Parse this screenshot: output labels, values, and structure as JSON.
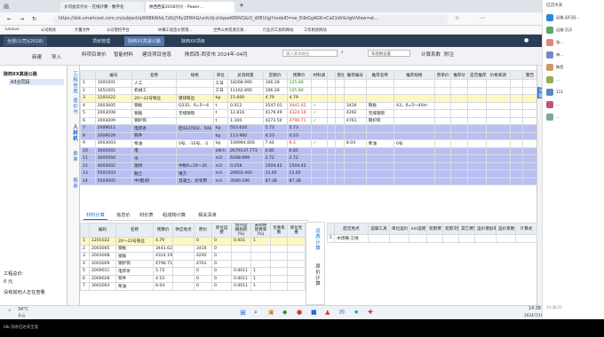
{
  "browser": {
    "tabs": [
      {
        "label": "大司会云计价 - 在线计算 - 数字化",
        "active": false
      },
      {
        "label": "陕西西安2018计价 - Power…",
        "active": true
      }
    ],
    "url": "https://dsk.smartcost.com.cn/subject/qW6BKAIfoL7d0/jY4y2EWhG/unit/dj-zUqewKRNVQ&i3_d0EU/gj?nodeID=oe_EdbGgAGK-nCa01dV&rightView=at...",
    "bookmarks": [
      "Lenovo",
      "公司相关",
      "计量文件",
      "公司管控平台",
      "纵横工程造价管理...",
      "世界公共资源交易...",
      "行业内工具和网站",
      "工作相关网站"
    ]
  },
  "app": {
    "tabs": [
      "全部(公司)(2018)",
      "项目管理",
      "陕西XX高速公路",
      "陕西XX项目"
    ],
    "toolbar": [
      "新建",
      "导入",
      "导出",
      "复制",
      "删除",
      "移动",
      "展开"
    ],
    "nav_labels": [
      "料项目单价",
      "智能材料",
      "建设项目信息",
      "陕西西-西安市 2024年-04月"
    ],
    "search_placeholder": "输入基本路径",
    "right_controls": [
      "车船税设置",
      "计算系数",
      "附注"
    ]
  },
  "left_panel": {
    "project": "陕西XX高速公路",
    "section": "A3合同段",
    "status_label": "工程总价:",
    "status_value": "0 元",
    "status_note": "没有其他人正在查看"
  },
  "side_nav": [
    "工程信息",
    "造价书",
    "人材机",
    "费率",
    "报表"
  ],
  "right_side_tabs": [
    "定额"
  ],
  "table1": {
    "headers": [
      "",
      "编号",
      "名称",
      "规格",
      "单位",
      "总消耗量",
      "定额价",
      "预算价",
      "材料类",
      "",
      "暂估",
      "推荐编号",
      "推荐名称",
      "推荐规格",
      "原单价",
      "推荐价",
      "是否推荐",
      "价格来源",
      "",
      "警告"
    ],
    "rows": [
      [
        "1",
        "1001001",
        "人工",
        "",
        "工日",
        "18268.995",
        "106.28",
        "105.88",
        "",
        "",
        "",
        "",
        "",
        "",
        "",
        "",
        "",
        "",
        "",
        ""
      ],
      [
        "2",
        "1051001",
        "机械工",
        "",
        "工日",
        "11162.895",
        "106.28",
        "105.88",
        "",
        "",
        "",
        "",
        "",
        "",
        "",
        "",
        "",
        "",
        "",
        ""
      ],
      [
        "3",
        "1201022",
        "20～22号铁丝",
        "镀锌铁丝",
        "kg",
        "15.600",
        "4.79",
        "4.79",
        "",
        "",
        "",
        "",
        "",
        "",
        "",
        "",
        "",
        "",
        "",
        ""
      ],
      [
        "4",
        "2003005",
        "钢板",
        "Q235、δ=5～4",
        "t",
        "0.012",
        "3547.01",
        "3441.62",
        "✓",
        "",
        "",
        "3416",
        "钢板",
        "A3，δ=5～40m",
        "",
        "",
        "",
        "",
        "",
        ""
      ],
      [
        "5",
        "2003008",
        "钢筋",
        "无缝钢管",
        "t",
        "12.816",
        "4179.49",
        "4324.19",
        "✓",
        "",
        "",
        "4292",
        "无缝钢管",
        "",
        "",
        "",
        "",
        "",
        "",
        ""
      ],
      [
        "6",
        "2003009",
        "钢护筒",
        "",
        "t",
        "1.100",
        "4273.50",
        "4796.71",
        "✓",
        "",
        "",
        "4761",
        "钢护筒",
        "",
        "",
        "",
        "",
        "",
        "",
        ""
      ],
      [
        "7",
        "2009011",
        "电焊条",
        "结422(502、506",
        "kg",
        "553.620",
        "5.73",
        "5.73",
        "",
        "",
        "",
        "",
        "",
        "",
        "",
        "",
        "",
        "",
        "",
        ""
      ],
      [
        "8",
        "2009028",
        "铁件",
        "",
        "kg",
        "113.960",
        "4.53",
        "4.53",
        "",
        "",
        "",
        "",
        "",
        "",
        "",
        "",
        "",
        "",
        "",
        ""
      ],
      [
        "9",
        "3003003",
        "柴油",
        "0号、-10号、-2",
        "kg",
        "108984.856",
        "7.44",
        "8.3",
        "✓",
        "",
        "",
        "8.04",
        "柴油",
        "0号",
        "",
        "",
        "",
        "",
        "",
        ""
      ],
      [
        "10",
        "3005002",
        "电",
        "",
        "kW·h",
        "2679137.773",
        "0.85",
        "0.85",
        "",
        "",
        "",
        "",
        "",
        "",
        "",
        "",
        "",
        "",
        "",
        ""
      ],
      [
        "11",
        "3005004",
        "水",
        "",
        "m3",
        "6268.099",
        "2.72",
        "2.72",
        "",
        "",
        "",
        "",
        "",
        "",
        "",
        "",
        "",
        "",
        "",
        ""
      ],
      [
        "12",
        "4003002",
        "锯材",
        "中板δ=19～35",
        "m3",
        "0.258",
        "1504.42",
        "1504.42",
        "",
        "",
        "",
        "",
        "",
        "",
        "",
        "",
        "",
        "",
        "",
        ""
      ],
      [
        "13",
        "5501003",
        "黏土",
        "堆方",
        "m3",
        "20603.492",
        "11.65",
        "11.65",
        "",
        "",
        "",
        "",
        "",
        "",
        "",
        "",
        "",
        "",
        "",
        ""
      ],
      [
        "14",
        "5503005",
        "中(粗)砂",
        "混凝土、砂浆用",
        "m3",
        "3580.196",
        "87.38",
        "87.38",
        "",
        "",
        "",
        "",
        "",
        "",
        "",
        "",
        "",
        "",
        "",
        ""
      ]
    ]
  },
  "bottom_tabs": [
    "材料计算",
    "信息价",
    "材价表",
    "组成物计算",
    "相关清单"
  ],
  "table2": {
    "headers": [
      "",
      "编码",
      "名称",
      "预算价",
      "供应地点",
      "原价",
      "单位运费",
      "场外运输损耗(%)",
      "采购保管费率(%)",
      "毛重系数",
      "单位毛重"
    ],
    "rows": [
      [
        "1",
        "1201022",
        "20～22号铁丝",
        "4.79",
        "",
        "0",
        "0",
        "0.001",
        "1",
        "",
        ""
      ],
      [
        "2",
        "2003005",
        "钢板",
        "3441.62",
        "",
        "3416",
        "0",
        "",
        "",
        "",
        ""
      ],
      [
        "3",
        "2003008",
        "钢筋",
        "4324.19",
        "",
        "4292",
        "0",
        "",
        "",
        "",
        ""
      ],
      [
        "4",
        "2003009",
        "钢护筒",
        "4796.71",
        "",
        "4761",
        "0",
        "",
        "",
        "",
        ""
      ],
      [
        "5",
        "2009011",
        "电焊条",
        "5.73",
        "",
        "0",
        "0",
        "0.0011",
        "1",
        "",
        ""
      ],
      [
        "6",
        "2009028",
        "铁件",
        "4.53",
        "",
        "0",
        "0",
        "0.0011",
        "1",
        "",
        ""
      ],
      [
        "7",
        "3003003",
        "柴油",
        "8.04",
        "",
        "0",
        "0",
        "0.0011",
        "1",
        "",
        ""
      ]
    ]
  },
  "vtool": [
    "运费计算",
    "原价计算"
  ],
  "table3": {
    "headers": [
      "",
      "起讫地点",
      "运输工具",
      "单位运价",
      "km运距",
      "装卸费",
      "装卸次数",
      "其它费用",
      "运价增加率(%)",
      "运价系数",
      "计算式"
    ],
    "rows": [
      [
        "1",
        "木场镇-工地",
        "",
        "",
        "",
        "",
        "",
        "",
        "",
        "",
        ""
      ]
    ]
  },
  "taskbar": {
    "weather_temp": "34°C",
    "weather_desc": "多云",
    "time": "14:38",
    "date": "2024/7/19"
  },
  "chat": {
    "title": "已沉今天",
    "items": [
      "运维.运行回...",
      "运维-沉天",
      "张…",
      "林…",
      "陕西",
      "…",
      "111",
      "…",
      "…"
    ],
    "timestamp": "14:38:51"
  },
  "bottom_status": "ldk-沟水已达天全流"
}
